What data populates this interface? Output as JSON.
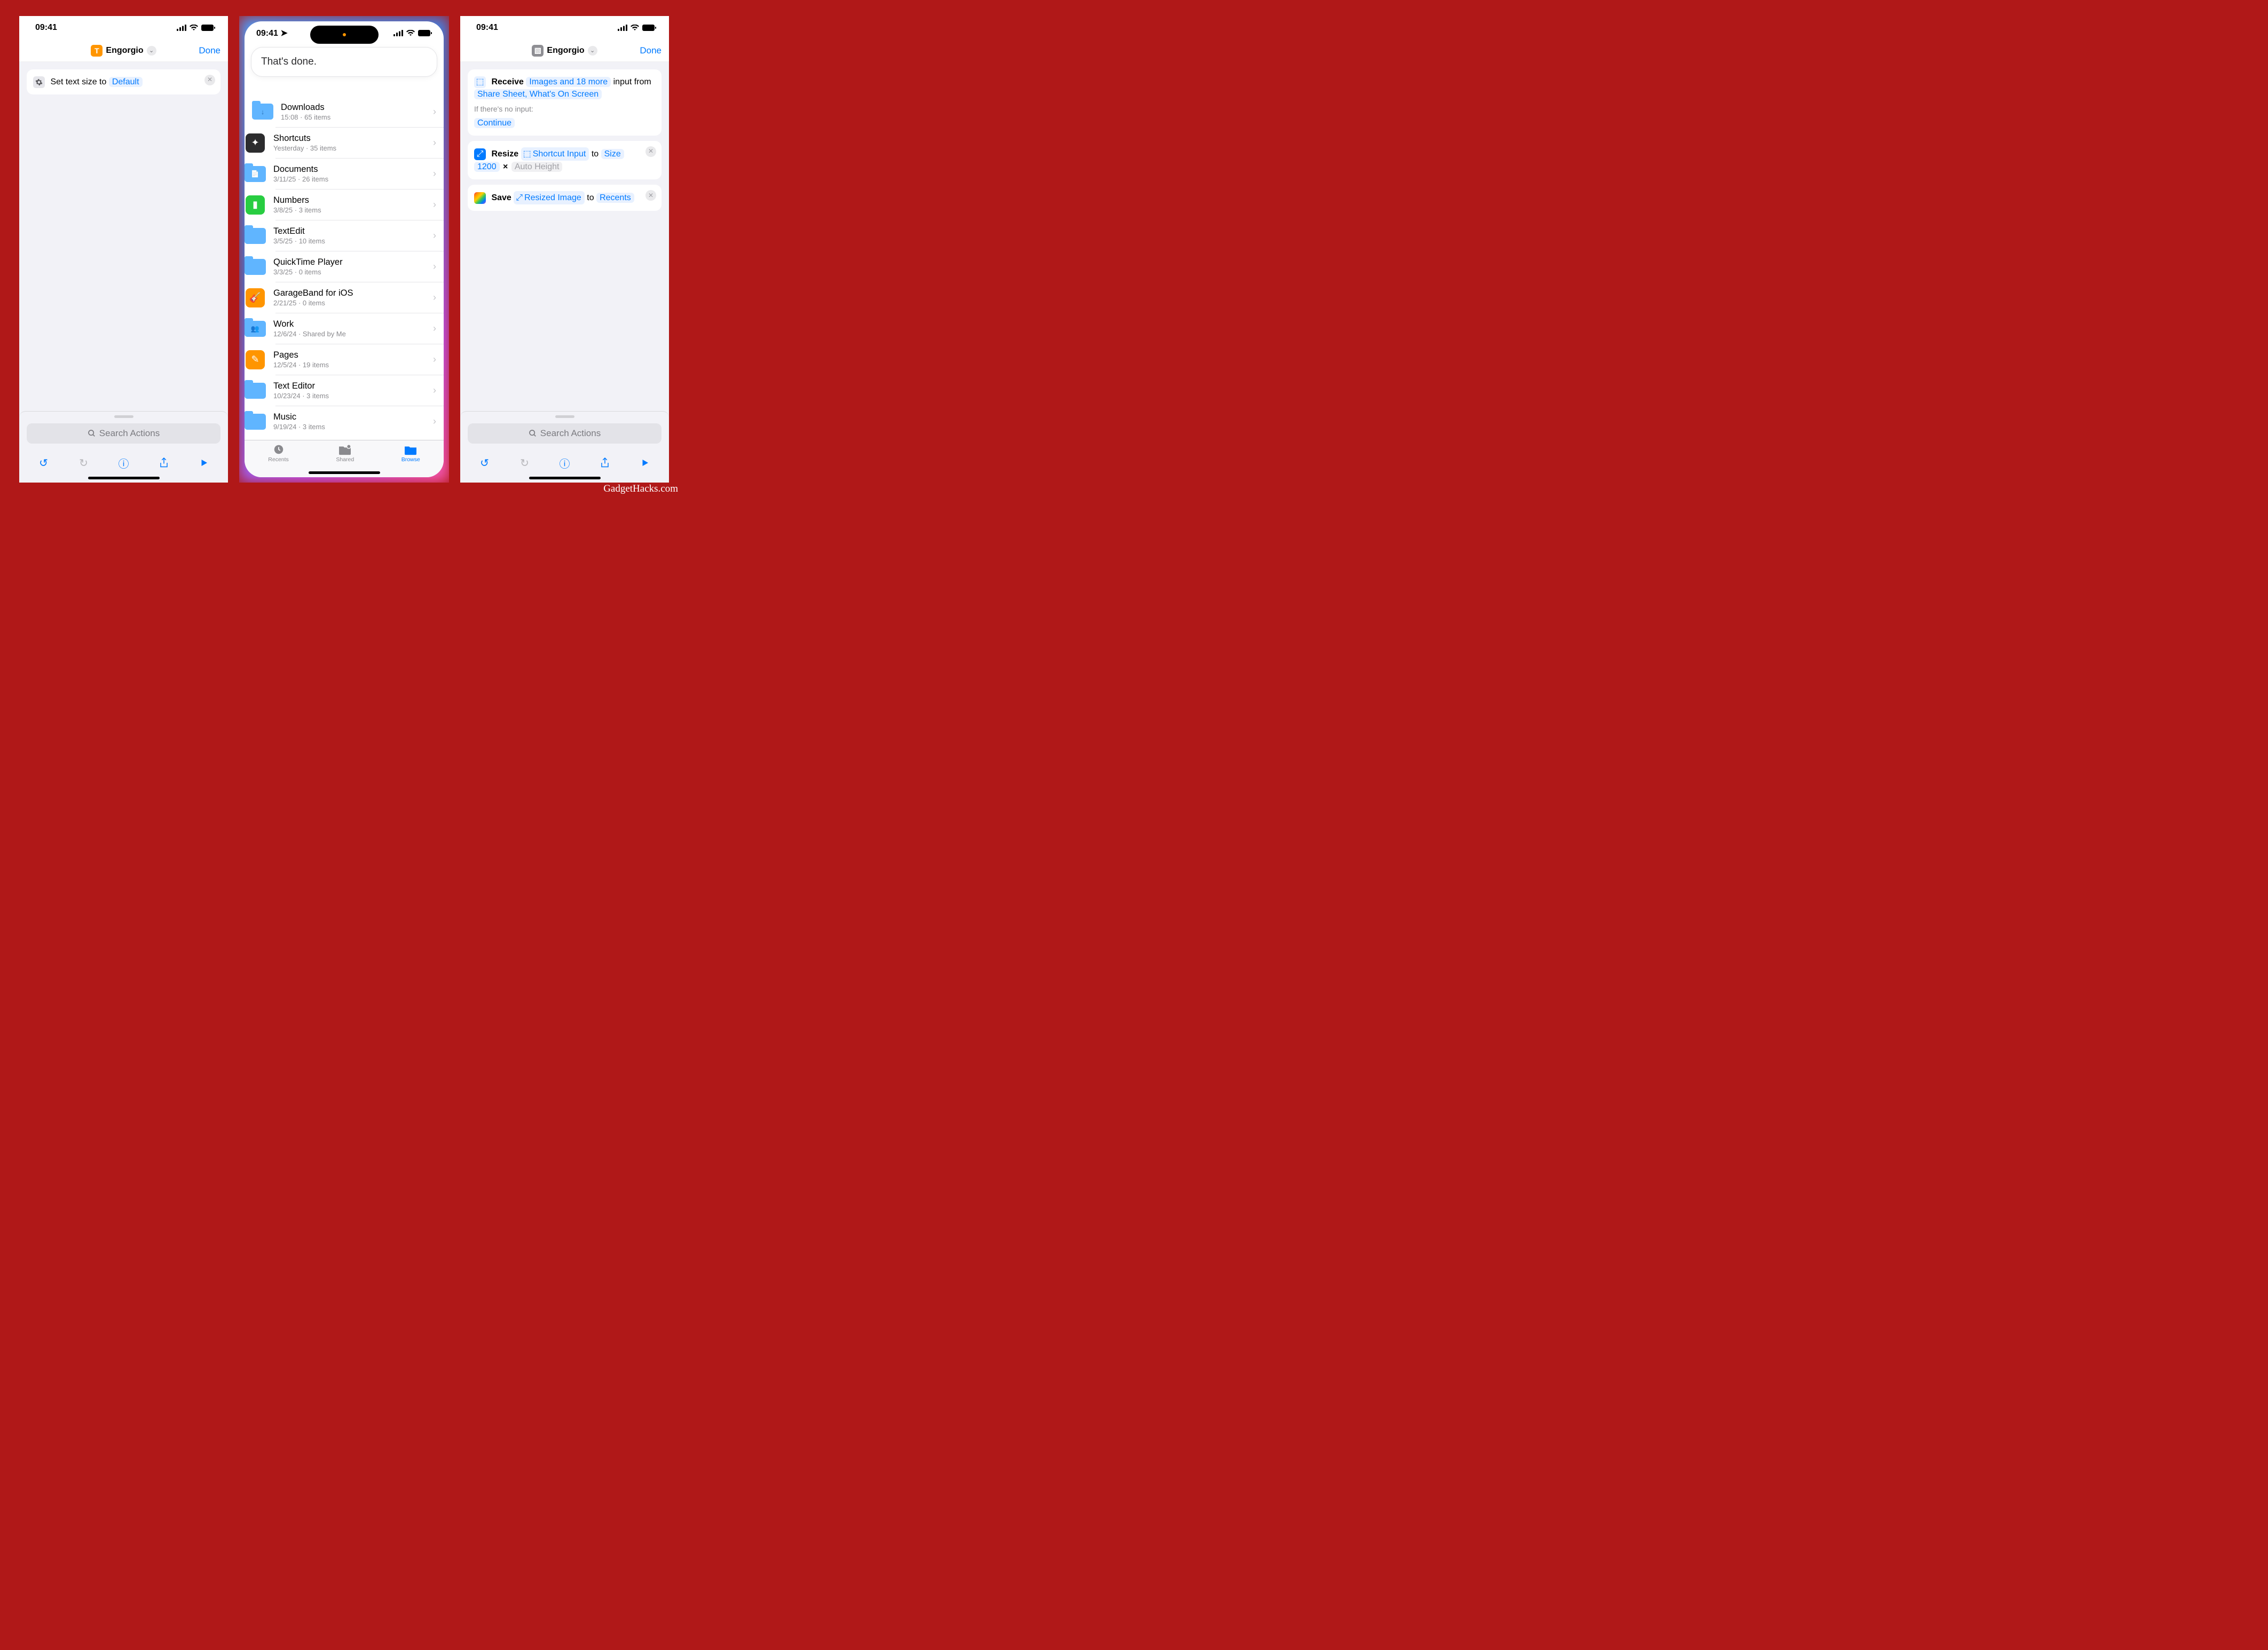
{
  "watermark": "GadgetHacks.com",
  "status": {
    "time": "09:41",
    "time_arrow": "09:41 ➤"
  },
  "panel1": {
    "title": "Engorgio",
    "done": "Done",
    "action": {
      "prefix": "Set text size to",
      "value": "Default"
    },
    "search_placeholder": "Search Actions"
  },
  "panel2": {
    "siri": "That's done.",
    "rows": [
      {
        "name": "Downloads",
        "sub": "15:08 · 65 items",
        "icon": "folder",
        "glyph": "↓"
      },
      {
        "name": "Shortcuts",
        "sub": "Yesterday · 35 items",
        "icon": "app",
        "bg": "#2c2c2e",
        "glyph": "✦"
      },
      {
        "name": "Documents",
        "sub": "3/11/25 · 26 items",
        "icon": "folder",
        "glyph": "📄"
      },
      {
        "name": "Numbers",
        "sub": "3/8/25 · 3 items",
        "icon": "app",
        "bg": "#28cd41",
        "glyph": "▮"
      },
      {
        "name": "TextEdit",
        "sub": "3/5/25 · 10 items",
        "icon": "folder",
        "glyph": ""
      },
      {
        "name": "QuickTime Player",
        "sub": "3/3/25 · 0 items",
        "icon": "folder",
        "glyph": ""
      },
      {
        "name": "GarageBand for iOS",
        "sub": "2/21/25 · 0 items",
        "icon": "app",
        "bg": "#ff9500",
        "glyph": "🎸"
      },
      {
        "name": "Work",
        "sub": "12/6/24 · Shared by Me",
        "icon": "folder",
        "glyph": "👥"
      },
      {
        "name": "Pages",
        "sub": "12/5/24 · 19 items",
        "icon": "app",
        "bg": "#ff9500",
        "glyph": "✎"
      },
      {
        "name": "Text Editor",
        "sub": "10/23/24 · 3 items",
        "icon": "folder",
        "glyph": ""
      },
      {
        "name": "Music",
        "sub": "9/19/24 · 3 items",
        "icon": "folder",
        "glyph": ""
      }
    ],
    "tabs": {
      "recents": "Recents",
      "shared": "Shared",
      "browse": "Browse"
    }
  },
  "panel3": {
    "title": "Engorgio",
    "done": "Done",
    "receive": {
      "verb": "Receive",
      "types": "Images and 18 more",
      "mid": "input from",
      "sources": "Share Sheet, What's On Screen",
      "noinput": "If there's no input:",
      "fallback": "Continue"
    },
    "resize": {
      "verb": "Resize",
      "input": "Shortcut Input",
      "to": "to",
      "size_label": "Size",
      "w": "1200",
      "sep": "×",
      "h": "Auto Height"
    },
    "save": {
      "verb": "Save",
      "input": "Resized Image",
      "to": "to",
      "dest": "Recents"
    },
    "search_placeholder": "Search Actions"
  }
}
